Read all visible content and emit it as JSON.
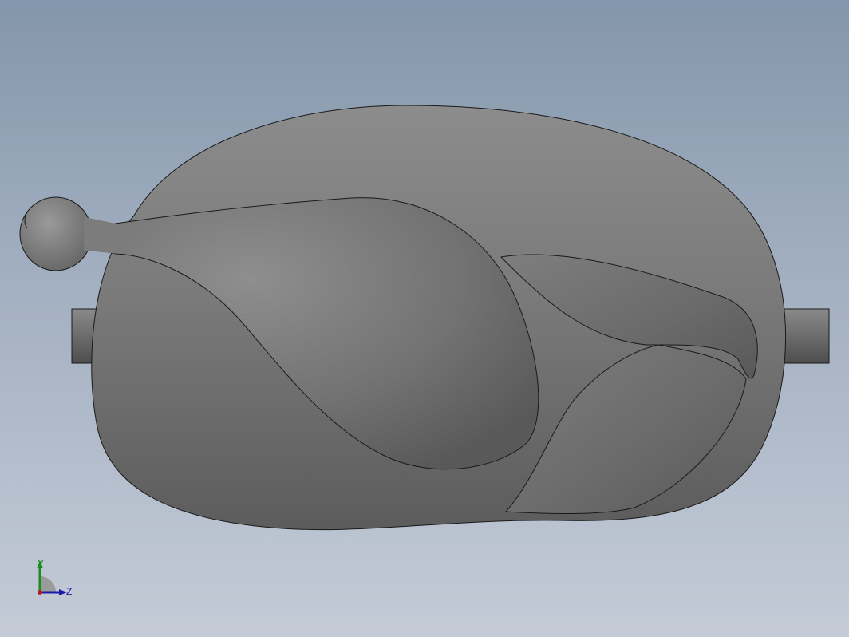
{
  "viewport": {
    "background_top": "#8496ab",
    "background_bottom": "#c4cbd7",
    "model_name": "roast-chicken"
  },
  "model": {
    "body_color": "#7a7a7a",
    "edge_color": "#1a1a1a",
    "shaft_color": "#6f6f6f"
  },
  "triad": {
    "y_label": "Y",
    "z_label": "Z",
    "y_color": "#1a8c1a",
    "z_color": "#1a1aa8",
    "origin_color": "#c01818"
  }
}
